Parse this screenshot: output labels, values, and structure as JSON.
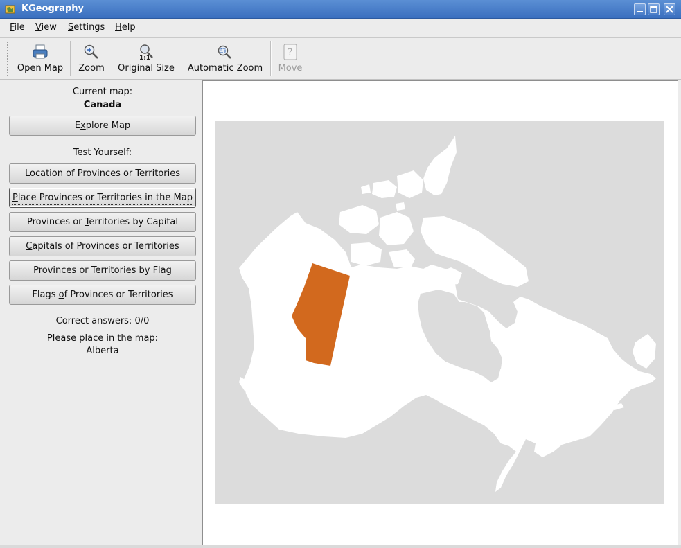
{
  "window": {
    "title": "KGeography",
    "icon": "kgeography-app-icon"
  },
  "menu": [
    {
      "first": "F",
      "rest": "ile"
    },
    {
      "first": "V",
      "rest": "iew"
    },
    {
      "first": "S",
      "rest": "ettings"
    },
    {
      "first": "H",
      "rest": "elp"
    }
  ],
  "toolbar": {
    "open_map": "Open Map",
    "zoom": "Zoom",
    "original_size": "Original Size",
    "auto_zoom": "Automatic Zoom",
    "move": "Move"
  },
  "panel": {
    "current_map_label": "Current map:",
    "current_map": "Canada",
    "explore_btn": {
      "pre": "E",
      "mn": "x",
      "post": "plore Map"
    },
    "test_label": "Test Yourself:",
    "quiz_buttons": [
      {
        "pre": "",
        "mn": "L",
        "post": "ocation of Provinces or Territories"
      },
      {
        "pre": "",
        "mn": "P",
        "post": "lace Provinces or Territories in the Map"
      },
      {
        "pre": "Provinces or ",
        "mn": "T",
        "post": "erritories by Capital"
      },
      {
        "pre": "",
        "mn": "C",
        "post": "apitals of Provinces or Territories"
      },
      {
        "pre": "Provinces or Territories ",
        "mn": "b",
        "post": "y Flag"
      },
      {
        "pre": "Flags ",
        "mn": "o",
        "post": "f Provinces or Territories"
      }
    ],
    "correct_answers": "Correct answers: 0/0",
    "prompt": "Please place in the map:",
    "target": "Alberta"
  },
  "map": {
    "highlight_color": "#d2691e",
    "land_color": "#ffffff",
    "water_color": "#dcdcdc"
  }
}
